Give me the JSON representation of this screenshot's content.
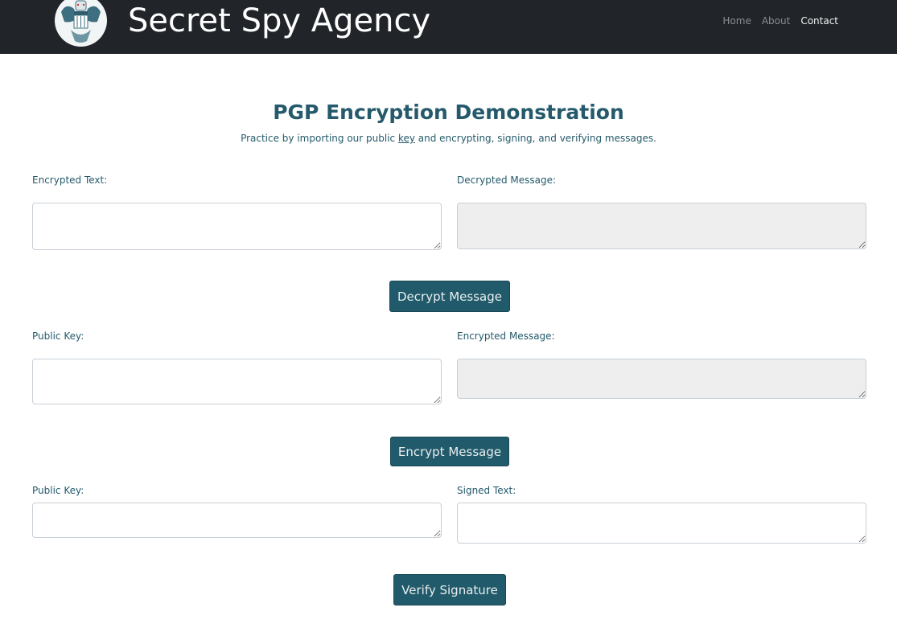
{
  "header": {
    "brand": "Secret Spy Agency",
    "logo_icon": "agency-seal-eagle-icon",
    "nav": [
      {
        "label": "Home",
        "active": false
      },
      {
        "label": "About",
        "active": false
      },
      {
        "label": "Contact",
        "active": true
      }
    ]
  },
  "main": {
    "title": "PGP Encryption Demonstration",
    "subtitle_before": "Practice by importing our public ",
    "subtitle_link": "key",
    "subtitle_after": " and encrypting, signing, and verifying messages."
  },
  "decrypt": {
    "input_label": "Encrypted Text:",
    "input_value": "",
    "output_label": "Decrypted Message:",
    "output_value": "",
    "button": "Decrypt Message"
  },
  "encrypt": {
    "input_label": "Public Key:",
    "input_value": "",
    "output_label": "Encrypted Message:",
    "output_value": "",
    "button": "Encrypt Message"
  },
  "verify": {
    "key_label": "Public Key:",
    "key_value": "",
    "signed_label": "Signed Text:",
    "signed_value": "",
    "button": "Verify Signature"
  },
  "colors": {
    "navbar_bg": "#212529",
    "accent": "#215a6a",
    "text": "#245a6b",
    "readonly_bg": "#eeeeee"
  }
}
